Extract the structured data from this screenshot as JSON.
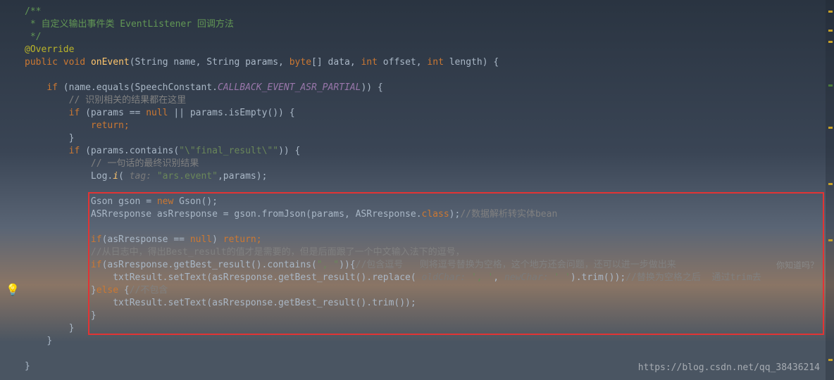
{
  "code": {
    "comment1": "/**",
    "comment2": " * 自定义输出事件类 EventListener 回调方法",
    "comment3": " */",
    "override": "@Override",
    "signature_public": "public ",
    "signature_void": "void ",
    "signature_method": "onEvent",
    "signature_params": "(String name, String params, ",
    "signature_byte": "byte",
    "signature_arr": "[] data, ",
    "signature_int1": "int ",
    "signature_offset": "offset, ",
    "signature_int2": "int ",
    "signature_length": "length) {",
    "if_name_equals": "if ",
    "if_name_equals_expr": "(name.equals(SpeechConstant.",
    "callback_const": "CALLBACK_EVENT_ASR_PARTIAL",
    "if_name_equals_close": ")) {",
    "comment_recog": "// 识别相关的结果都在这里",
    "if_params_null": "if ",
    "if_params_null_expr": "(params == ",
    "null_kw": "null ",
    "or_params_empty": "|| params.isEmpty()) {",
    "return_stmt": "return;",
    "close_brace1": "}",
    "if_contains": "if ",
    "if_contains_expr": "(params.contains(",
    "final_result_str": "\"\\\"final_result\\\"\"",
    "if_contains_close": ")) {",
    "comment_final": "// 一句话的最终识别结果",
    "log_i": "Log.",
    "log_method": "i",
    "log_open": "( ",
    "tag_hint": "tag: ",
    "tag_str": "\"ars.event\"",
    "log_params": ",params);",
    "gson_decl": "Gson gson = ",
    "new_kw": "new ",
    "gson_ctor": "Gson();",
    "asr_decl": "ASRresponse asRresponse = gson.fromJson(params, ASRresponse.",
    "class_kw": "class",
    "asr_close": ");",
    "asr_comment": "//数据解析转实体bean",
    "if_asr_null": "if",
    "if_asr_null_expr": "(asRresponse == ",
    "null_kw2": "null",
    "if_asr_return": ") ",
    "return_kw": "return;",
    "comment_log": "//从日志中，得出Best_result的值才是需要的，但是后面跟了一个中文输入法下的逗号，",
    "if_best": "if",
    "if_best_expr": "(asRresponse.getBest_result().contains(",
    "comma_str": "\", \"",
    "if_best_close": ")){",
    "comment_contain": "//包含逗号   则将逗号替换为空格，这个地方还会问题，还可以进一步做出来",
    "txt_set1": "txtResult.setText(asRresponse.getBest_result().replace( ",
    "old_char_hint": "oldChar: ",
    "old_char": "', '",
    "comma_sep": ", ",
    "new_char_hint": "newChar: ",
    "new_char": "' '",
    "trim_close1": ").trim());",
    "comment_replace": "//替换为空格之后",
    "comment_trim_end": "通过trim去",
    "else_kw": "}",
    "else_stmt": "else ",
    "else_open": "{",
    "comment_not_contain": "//不包含",
    "txt_set2": "txtResult.setText(asRresponse.getBest_result().trim());",
    "close_brace2": "}",
    "close_brace3": "}",
    "close_brace4": "}",
    "close_brace5": "}"
  },
  "side_text": "你知道吗？",
  "watermark": "https://blog.csdn.net/qq_38436214"
}
